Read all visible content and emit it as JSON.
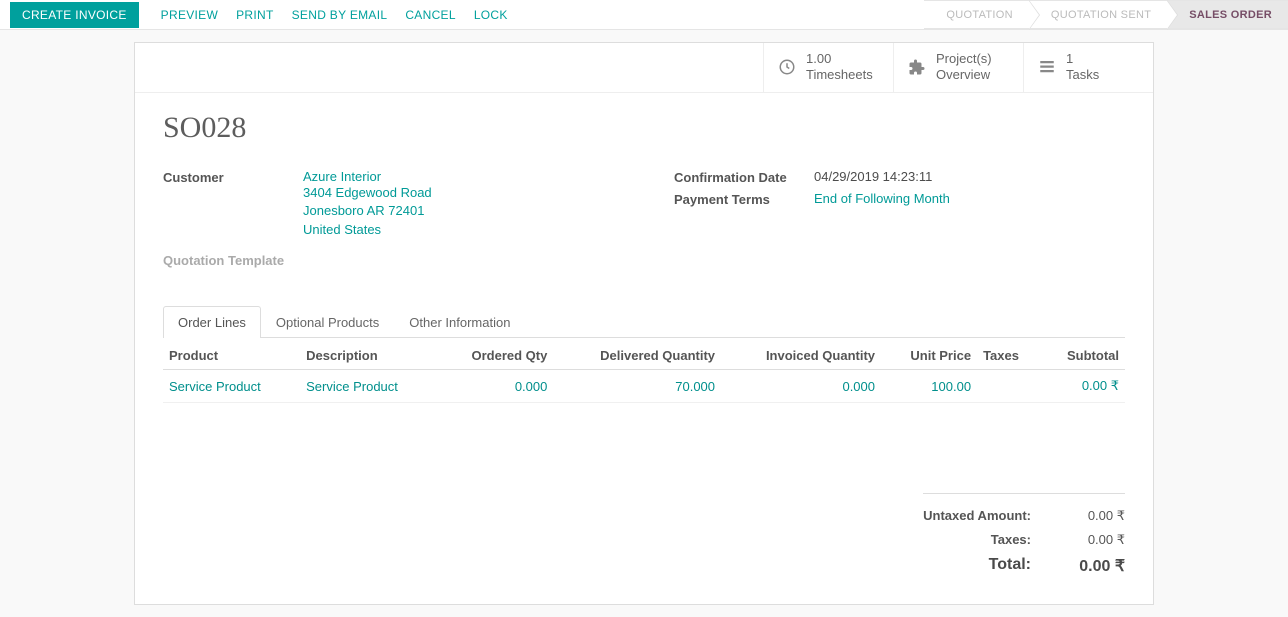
{
  "toolbar": {
    "create_invoice": "CREATE INVOICE",
    "preview": "PREVIEW",
    "print": "PRINT",
    "send_by_email": "SEND BY EMAIL",
    "cancel": "CANCEL",
    "lock": "LOCK"
  },
  "status": {
    "quotation": "QUOTATION",
    "quotation_sent": "QUOTATION SENT",
    "sales_order": "SALES ORDER"
  },
  "stats": {
    "timesheets_value": "1.00",
    "timesheets_label": "Timesheets",
    "projects_label_line1": "Project(s)",
    "projects_label_line2": "Overview",
    "tasks_value": "1",
    "tasks_label": "Tasks"
  },
  "order": {
    "name": "SO028",
    "customer_label": "Customer",
    "customer_name": "Azure Interior",
    "customer_address1": "3404 Edgewood Road",
    "customer_address2": "Jonesboro AR 72401",
    "customer_country": "United States",
    "quotation_template_label": "Quotation Template",
    "confirmation_date_label": "Confirmation Date",
    "confirmation_date": "04/29/2019 14:23:11",
    "payment_terms_label": "Payment Terms",
    "payment_terms": "End of Following Month"
  },
  "tabs": {
    "order_lines": "Order Lines",
    "optional_products": "Optional Products",
    "other_information": "Other Information"
  },
  "columns": {
    "product": "Product",
    "description": "Description",
    "ordered_qty": "Ordered Qty",
    "delivered_qty": "Delivered Quantity",
    "invoiced_qty": "Invoiced Quantity",
    "unit_price": "Unit Price",
    "taxes": "Taxes",
    "subtotal": "Subtotal"
  },
  "lines": [
    {
      "product": "Service Product",
      "description": "Service Product",
      "ordered_qty": "0.000",
      "delivered_qty": "70.000",
      "invoiced_qty": "0.000",
      "unit_price": "100.00",
      "taxes": "",
      "subtotal": "0.00 ₹"
    }
  ],
  "totals": {
    "untaxed_label": "Untaxed Amount:",
    "untaxed_value": "0.00 ₹",
    "taxes_label": "Taxes:",
    "taxes_value": "0.00 ₹",
    "total_label": "Total:",
    "total_value": "0.00 ₹"
  },
  "currency_symbol": "₹"
}
